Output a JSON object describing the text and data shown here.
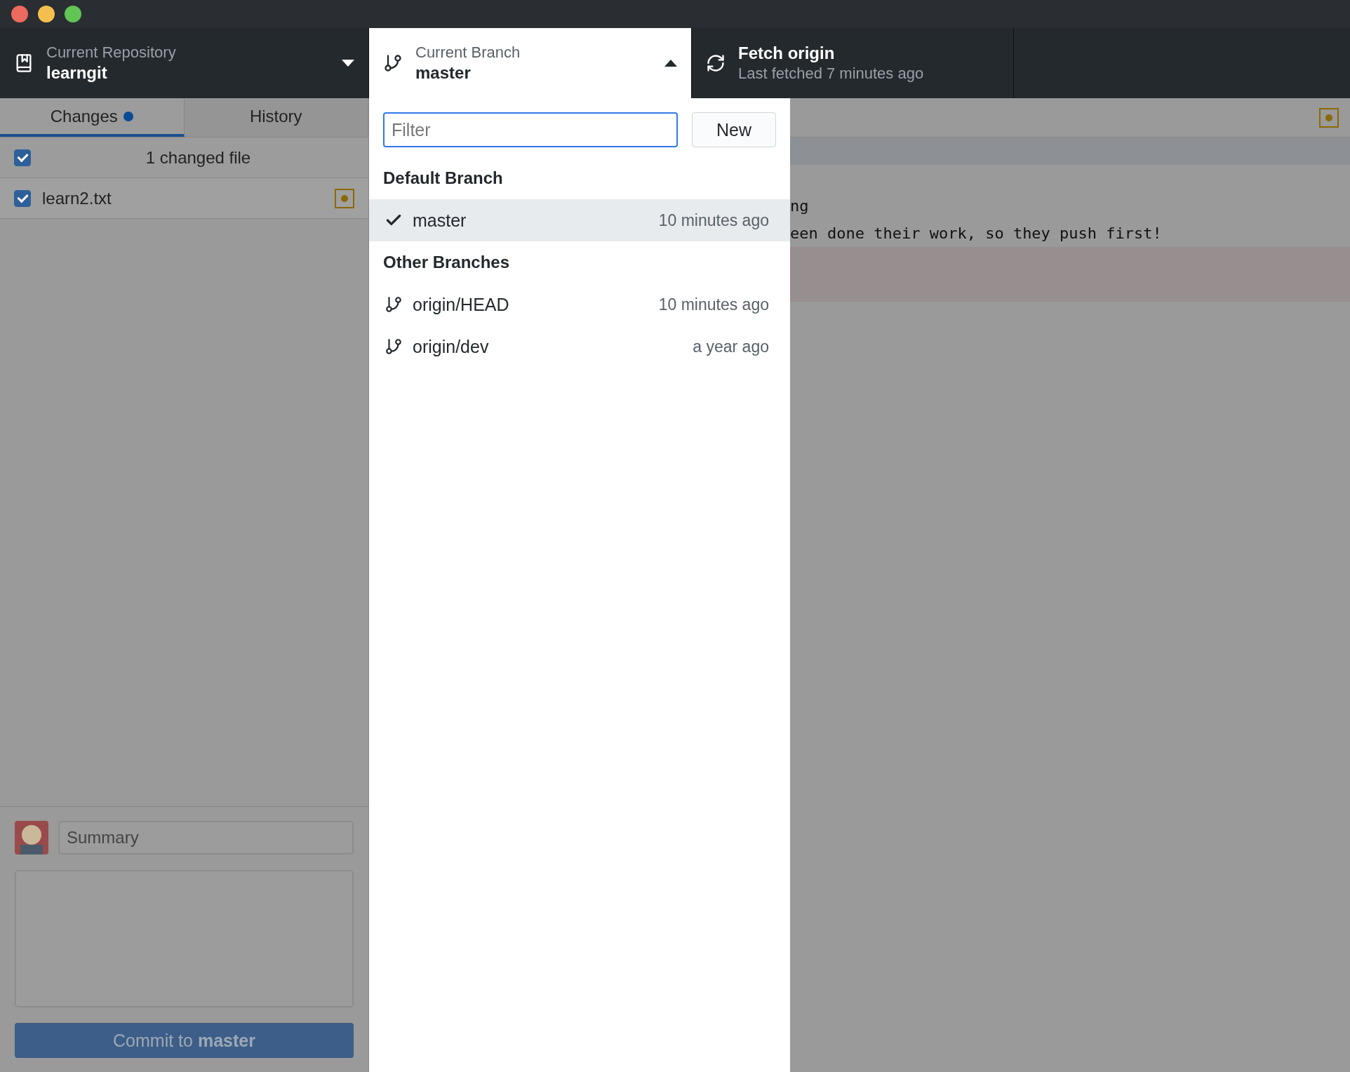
{
  "toolbar": {
    "repository": {
      "label": "Current Repository",
      "name": "learngit"
    },
    "branch": {
      "label": "Current Branch",
      "name": "master",
      "expanded": true
    },
    "fetch": {
      "title": "Fetch origin",
      "subtitle": "Last fetched 7 minutes ago"
    }
  },
  "sidebar": {
    "tabs": [
      {
        "label": "Changes",
        "selected": true,
        "dot": true
      },
      {
        "label": "History",
        "selected": false,
        "dot": false
      }
    ],
    "header": {
      "checked": true,
      "text": "1 changed file"
    },
    "files": [
      {
        "name": "learn2.txt",
        "checked": true
      }
    ],
    "commit": {
      "placeholder": "Summary",
      "button": "Commit to **master**"
    }
  },
  "diff": {
    "lines": [
      {
        "kind": "hunk"
      },
      {
        "kind": "context",
        "text": "ng"
      },
      {
        "kind": "context",
        "text": "een done their work, so they push first!"
      },
      {
        "kind": "deleted"
      },
      {
        "kind": "deleted"
      }
    ]
  },
  "dropdown": {
    "filter": {
      "placeholder": "Filter"
    },
    "new_button": "New",
    "groups": [
      {
        "title": "Default Branch",
        "branches": [
          {
            "name": "master",
            "time": "10 minutes ago",
            "selected": true
          }
        ]
      },
      {
        "title": "Other Branches",
        "branches": [
          {
            "name": "origin/HEAD",
            "time": "10 minutes ago",
            "selected": false
          },
          {
            "name": "origin/dev",
            "time": "a year ago",
            "selected": false
          }
        ]
      }
    ]
  }
}
